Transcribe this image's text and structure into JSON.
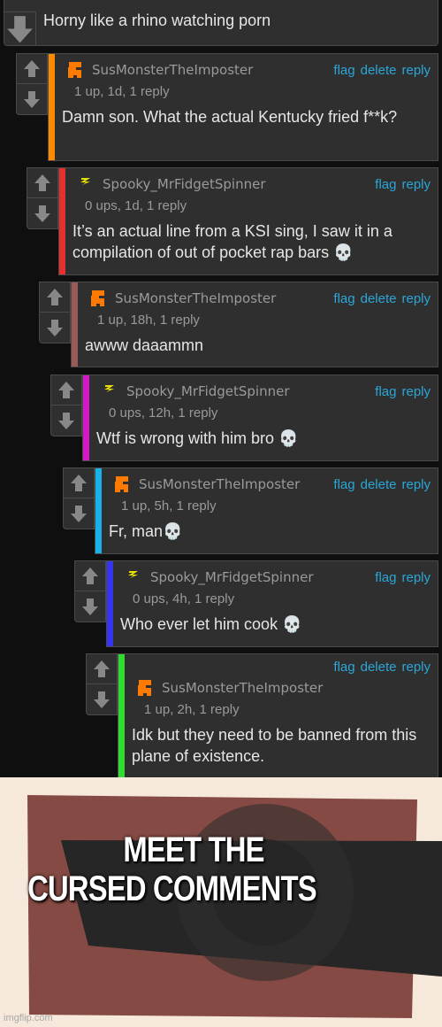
{
  "top_comment": {
    "text": "Horny like a rhino watching porn"
  },
  "comments": [
    {
      "user": "SusMonsterTheImposter",
      "avatar": "orange-pixel-avatar",
      "meta": "1 up, 1d, 1 reply",
      "text": "Damn son. What the actual Kentucky fried f**k?",
      "actions": [
        "flag",
        "delete",
        "reply"
      ],
      "bar_color": "#ff8a00"
    },
    {
      "user": "Spooky_MrFidgetSpinner",
      "avatar": "yellow-bolt-avatar",
      "meta": "0 ups, 1d, 1 reply",
      "text": "It’s an actual line from a KSI sing, I saw it in a compilation of out of pocket rap bars 💀",
      "actions": [
        "flag",
        "reply"
      ],
      "bar_color": "#e63030"
    },
    {
      "user": "SusMonsterTheImposter",
      "avatar": "orange-pixel-avatar",
      "meta": "1 up, 18h, 1 reply",
      "text": "awww daaammn",
      "actions": [
        "flag",
        "delete",
        "reply"
      ],
      "bar_color": "#9a5a5a"
    },
    {
      "user": "Spooky_MrFidgetSpinner",
      "avatar": "yellow-bolt-avatar",
      "meta": "0 ups, 12h, 1 reply",
      "text": "Wtf is wrong with him bro 💀",
      "actions": [
        "flag",
        "reply"
      ],
      "bar_color": "#d418c8"
    },
    {
      "user": "SusMonsterTheImposter",
      "avatar": "orange-pixel-avatar",
      "meta": "1 up, 5h, 1 reply",
      "text": "Fr, man💀",
      "actions": [
        "flag",
        "delete",
        "reply"
      ],
      "bar_color": "#1ab0e8"
    },
    {
      "user": "Spooky_MrFidgetSpinner",
      "avatar": "yellow-bolt-avatar",
      "meta": "0 ups, 4h, 1 reply",
      "text": "Who ever let him cook 💀",
      "actions": [
        "flag",
        "reply"
      ],
      "bar_color": "#3535f0"
    },
    {
      "user": "SusMonsterTheImposter",
      "avatar": "orange-pixel-avatar",
      "meta": "1 up, 2h, 1 reply",
      "text": "Idk but they need to be banned from this plane of existence.",
      "actions": [
        "flag",
        "delete",
        "reply"
      ],
      "bar_color": "#2fdc2f"
    }
  ],
  "meme": {
    "line1": "MEET THE",
    "line2": "CURSED COMMENTS",
    "watermark": "imgflip.com"
  },
  "colors": {
    "link": "#2aa7d8",
    "panel": "#2f2f2f",
    "background": "#0f0f0f",
    "meme_red": "#854a43",
    "meme_dark": "#262626",
    "meme_bg": "#f6e9dc"
  }
}
